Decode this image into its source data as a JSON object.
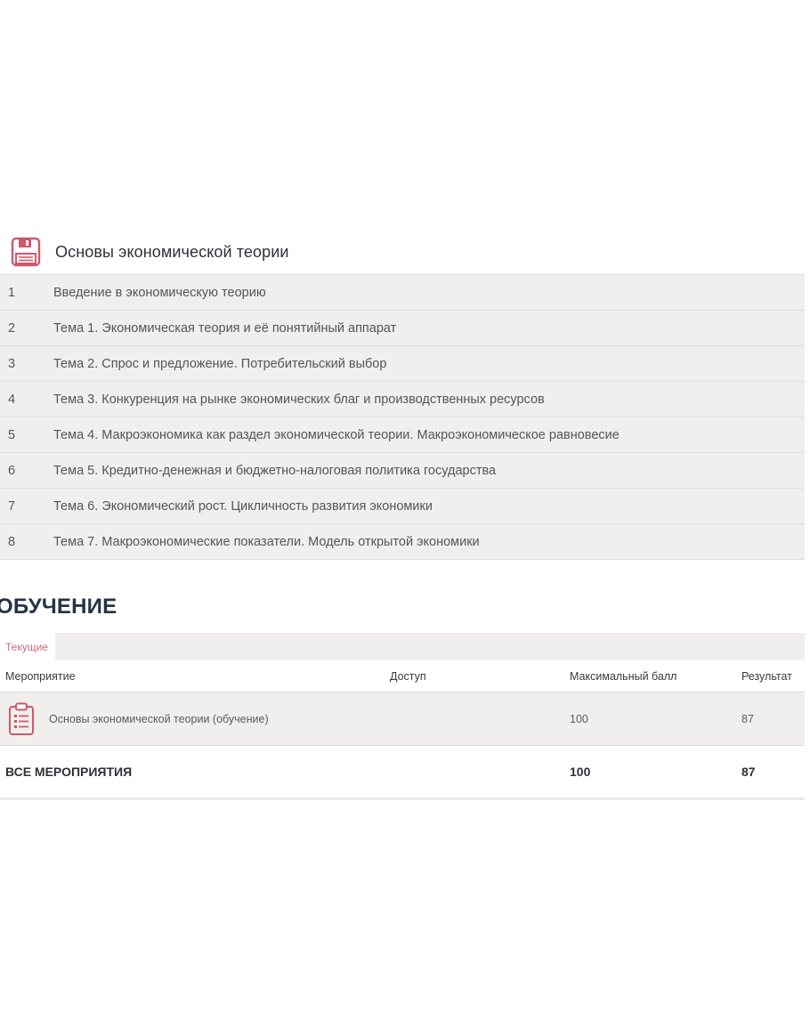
{
  "course": {
    "icon": "floppy-disk-icon",
    "title": "Основы экономической теории",
    "topics": [
      {
        "num": "1",
        "text": "Введение в экономическую теорию"
      },
      {
        "num": "2",
        "text": "Тема 1. Экономическая теория и её понятийный аппарат"
      },
      {
        "num": "3",
        "text": "Тема 2. Спрос и предложение. Потребительский выбор"
      },
      {
        "num": "4",
        "text": "Тема 3. Конкуренция на рынке экономических благ и производственных ресурсов"
      },
      {
        "num": "5",
        "text": "Тема 4. Макроэкономика как раздел экономической теории. Макроэкономическое равновесие"
      },
      {
        "num": "6",
        "text": "Тема 5. Кредитно-денежная и бюджетно-налоговая политика государства"
      },
      {
        "num": "7",
        "text": "Тема 6. Экономический рост. Цикличность развития экономики"
      },
      {
        "num": "8",
        "text": "Тема 7. Макроэкономические показатели. Модель открытой экономики"
      }
    ]
  },
  "training": {
    "title": "ОБУЧЕНИЕ",
    "tab_current": "Текущие",
    "columns": {
      "event": "Мероприятие",
      "access": "Доступ",
      "max_score": "Максимальный балл",
      "result": "Результат"
    },
    "rows": [
      {
        "icon": "clipboard-list-icon",
        "event": "Основы экономической теории (обучение)",
        "access": "",
        "max_score": "100",
        "result": "87"
      }
    ],
    "total": {
      "label": "ВСЕ МЕРОПРИЯТИЯ",
      "max_score": "100",
      "result": "87"
    }
  },
  "colors": {
    "accent": "#d0586a",
    "heading": "#243348",
    "row_background": "#f0efed"
  }
}
